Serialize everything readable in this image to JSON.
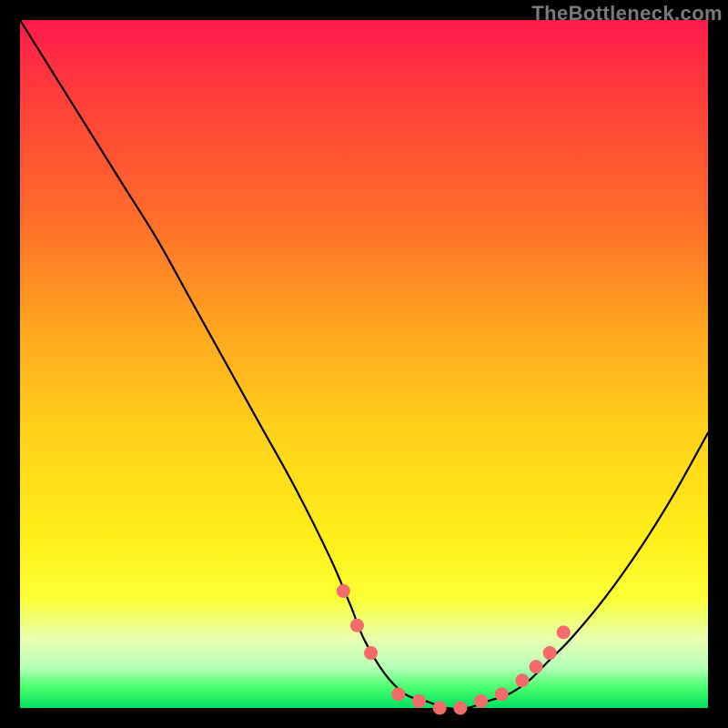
{
  "watermark": "TheBottleneck.com",
  "chart_data": {
    "type": "line",
    "title": "",
    "xlabel": "",
    "ylabel": "",
    "xlim": [
      0,
      100
    ],
    "ylim": [
      0,
      100
    ],
    "grid": false,
    "series": [
      {
        "name": "bottleneck-curve",
        "x": [
          0,
          5,
          10,
          15,
          20,
          25,
          30,
          35,
          40,
          45,
          48,
          50,
          53,
          56,
          59,
          62,
          65,
          68,
          71,
          74,
          77,
          80,
          85,
          90,
          95,
          100
        ],
        "values": [
          100,
          92,
          84,
          76,
          68,
          59,
          50,
          41,
          32,
          22,
          15,
          10,
          5,
          2,
          1,
          0,
          0,
          1,
          2,
          4,
          7,
          10,
          16,
          23,
          31,
          40
        ]
      }
    ],
    "markers": {
      "name": "highlight-dots",
      "color": "#f36b6b",
      "x": [
        47,
        49,
        51,
        55,
        58,
        61,
        64,
        67,
        70,
        73,
        75,
        77,
        79
      ],
      "values": [
        17,
        12,
        8,
        2,
        1,
        0,
        0,
        1,
        2,
        4,
        6,
        8,
        11
      ]
    }
  }
}
